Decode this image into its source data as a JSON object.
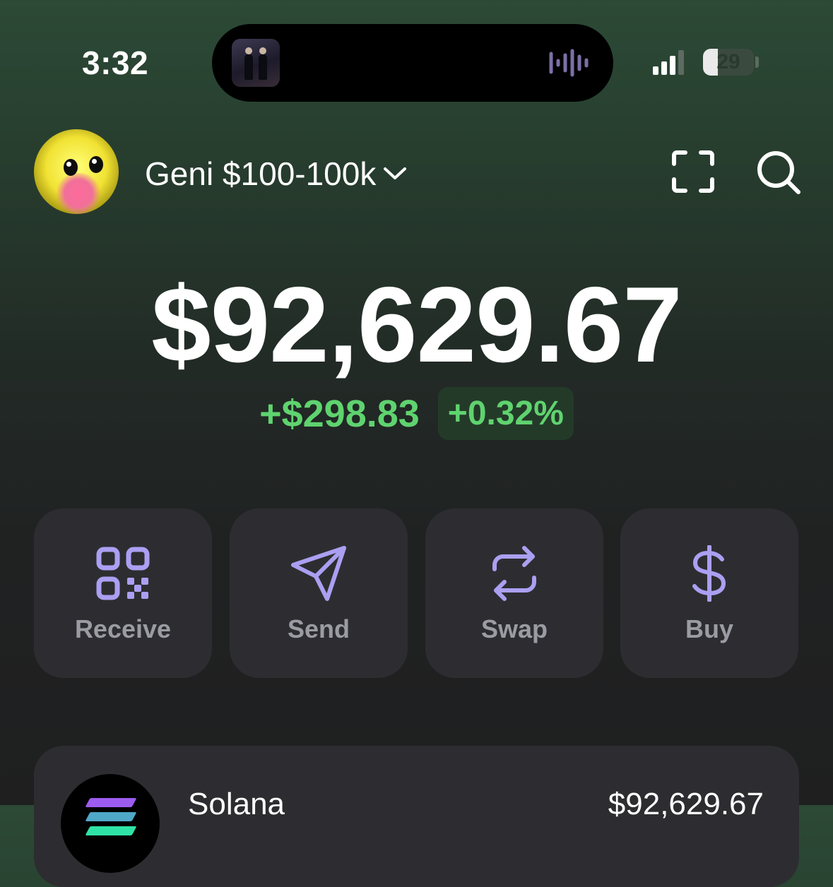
{
  "status_bar": {
    "time": "3:32",
    "battery_level": "29",
    "battery_fraction": 0.29,
    "now_playing_icon": "music-artwork-thumbnail",
    "waveform_icon": "audio-waveform-icon"
  },
  "header": {
    "account_name": "Geni $100-100k",
    "account_chevron_icon": "chevron-down-icon",
    "scan_icon": "scan-frame-icon",
    "search_icon": "search-icon"
  },
  "balance": {
    "total": "$92,629.67",
    "change_amount": "+$298.83",
    "change_percent": "+0.32%"
  },
  "actions": [
    {
      "label": "Receive",
      "icon": "qr-code-icon"
    },
    {
      "label": "Send",
      "icon": "paper-plane-icon"
    },
    {
      "label": "Swap",
      "icon": "swap-arrows-icon"
    },
    {
      "label": "Buy",
      "icon": "dollar-sign-icon"
    }
  ],
  "tokens": [
    {
      "name": "Solana",
      "value": "$92,629.67",
      "icon": "solana-logo-icon"
    }
  ],
  "colors": {
    "accent": "#ab9ff2",
    "positive": "#5fd36f",
    "card_bg": "#2d2d31",
    "label_muted": "#9b9ba3"
  }
}
